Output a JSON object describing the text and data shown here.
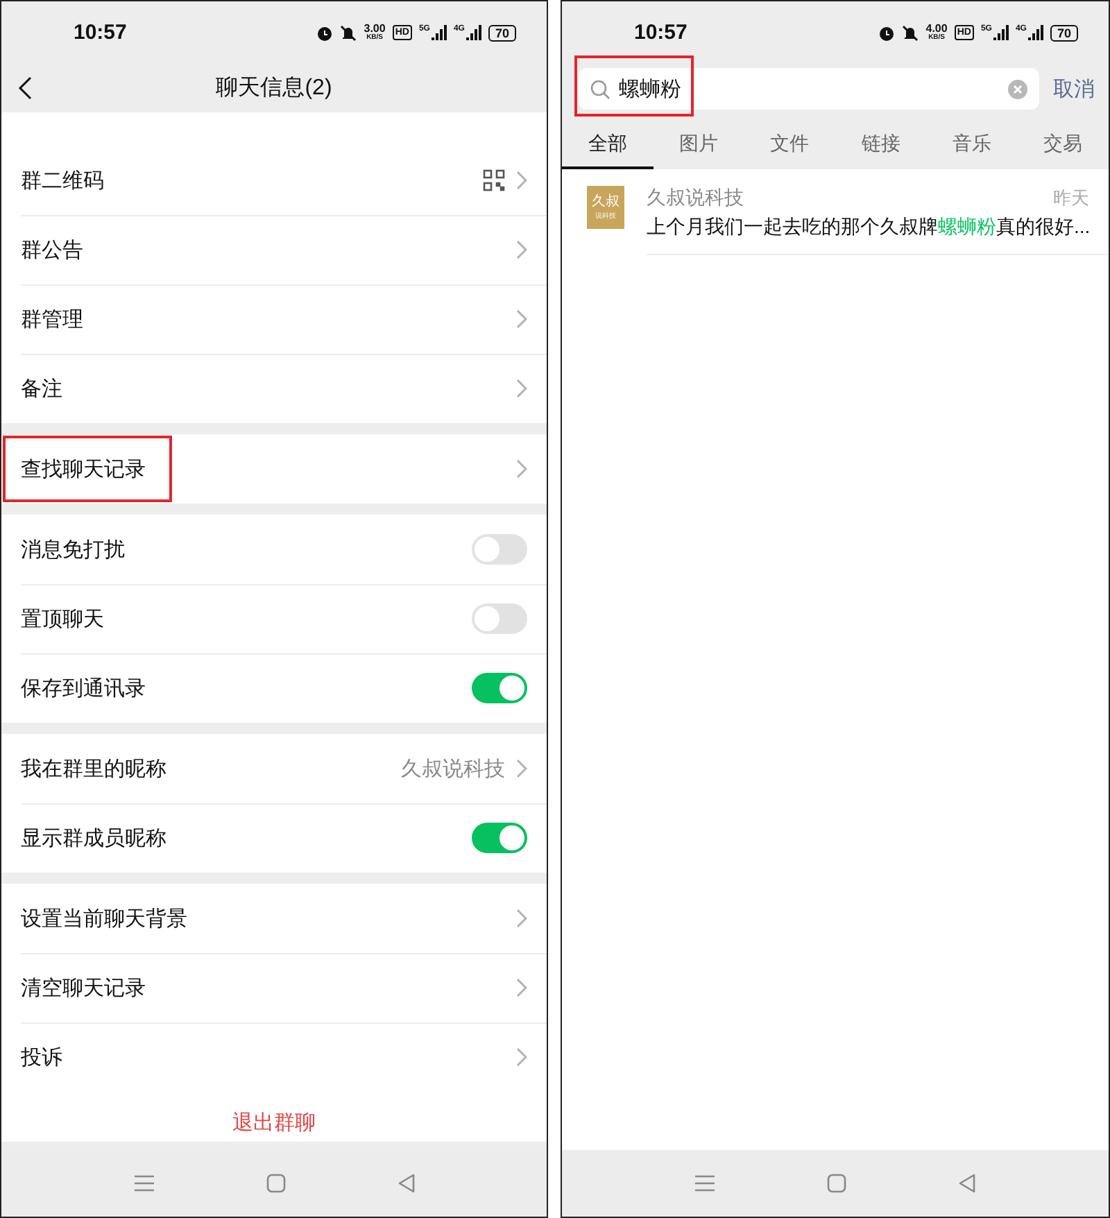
{
  "left_screen": {
    "status_bar": {
      "time": "10:57",
      "speed": "3.00",
      "speed_unit": "KB/S",
      "hd": "HD",
      "network_1": "5G",
      "network_2": "4G",
      "battery": "70"
    },
    "title": "聊天信息(2)",
    "sections": [
      [
        {
          "kind": "qr",
          "label": "群二维码",
          "highlighted": false
        },
        {
          "kind": "link",
          "label": "群公告",
          "highlighted": false
        },
        {
          "kind": "link",
          "label": "群管理",
          "highlighted": false
        },
        {
          "kind": "link",
          "label": "备注",
          "highlighted": false
        }
      ],
      [
        {
          "kind": "link",
          "label": "查找聊天记录",
          "highlighted": true
        }
      ],
      [
        {
          "kind": "toggle",
          "label": "消息免打扰",
          "on": false,
          "highlighted": false
        },
        {
          "kind": "toggle",
          "label": "置顶聊天",
          "on": false,
          "highlighted": false
        },
        {
          "kind": "toggle",
          "label": "保存到通讯录",
          "on": true,
          "highlighted": false
        }
      ],
      [
        {
          "kind": "value",
          "label": "我在群里的昵称",
          "value": "久叔说科技",
          "highlighted": false
        },
        {
          "kind": "toggle",
          "label": "显示群成员昵称",
          "on": true,
          "highlighted": false
        }
      ],
      [
        {
          "kind": "link",
          "label": "设置当前聊天背景",
          "highlighted": false
        },
        {
          "kind": "link",
          "label": "清空聊天记录",
          "highlighted": false
        },
        {
          "kind": "link",
          "label": "投诉",
          "highlighted": false
        }
      ]
    ],
    "exit_button": "退出群聊"
  },
  "right_screen": {
    "status_bar": {
      "time": "10:57",
      "speed": "4.00",
      "speed_unit": "KB/S",
      "hd": "HD",
      "network_1": "5G",
      "network_2": "4G",
      "battery": "70"
    },
    "search": {
      "value": "螺蛳粉",
      "highlighted": true
    },
    "cancel": "取消",
    "tabs": [
      {
        "label": "全部",
        "selected": true
      },
      {
        "label": "图片",
        "selected": false
      },
      {
        "label": "文件",
        "selected": false
      },
      {
        "label": "链接",
        "selected": false
      },
      {
        "label": "音乐",
        "selected": false
      },
      {
        "label": "交易",
        "selected": false
      }
    ],
    "results": [
      {
        "avatar_title": "久叔",
        "avatar_subtitle": "说科技",
        "name": "久叔说科技",
        "time": "昨天",
        "snippet": "上个月我们一起去吃的那个久叔牌**螺蛳粉**真的很好..."
      }
    ]
  }
}
